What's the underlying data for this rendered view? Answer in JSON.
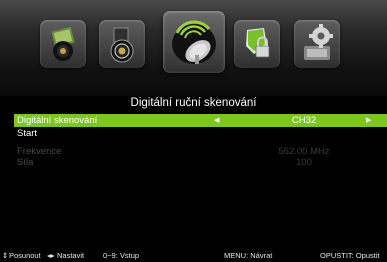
{
  "menu": {
    "icons": [
      {
        "name": "picture-icon"
      },
      {
        "name": "sound-icon"
      },
      {
        "name": "channel-icon"
      },
      {
        "name": "lock-icon"
      },
      {
        "name": "setup-icon"
      }
    ],
    "active_index": 2
  },
  "title": "Digitální ruční skenování",
  "rows": [
    {
      "label": "Digitální skenování",
      "value": "CH32",
      "selected": true
    },
    {
      "label": "Start",
      "value": "",
      "selected": false
    },
    {
      "label": "Frekvence",
      "value": "562.00 MHz",
      "selected": false
    },
    {
      "label": "Síla",
      "value": "100",
      "selected": false
    }
  ],
  "footer": {
    "move": "Posunout",
    "set": "Nastavit",
    "input": "0~9: Vstup",
    "menu": "MENU: Návrat",
    "exit": "OPUSTIT: Opustit"
  },
  "colors": {
    "highlight": "#7bc720",
    "background": "#000000"
  }
}
